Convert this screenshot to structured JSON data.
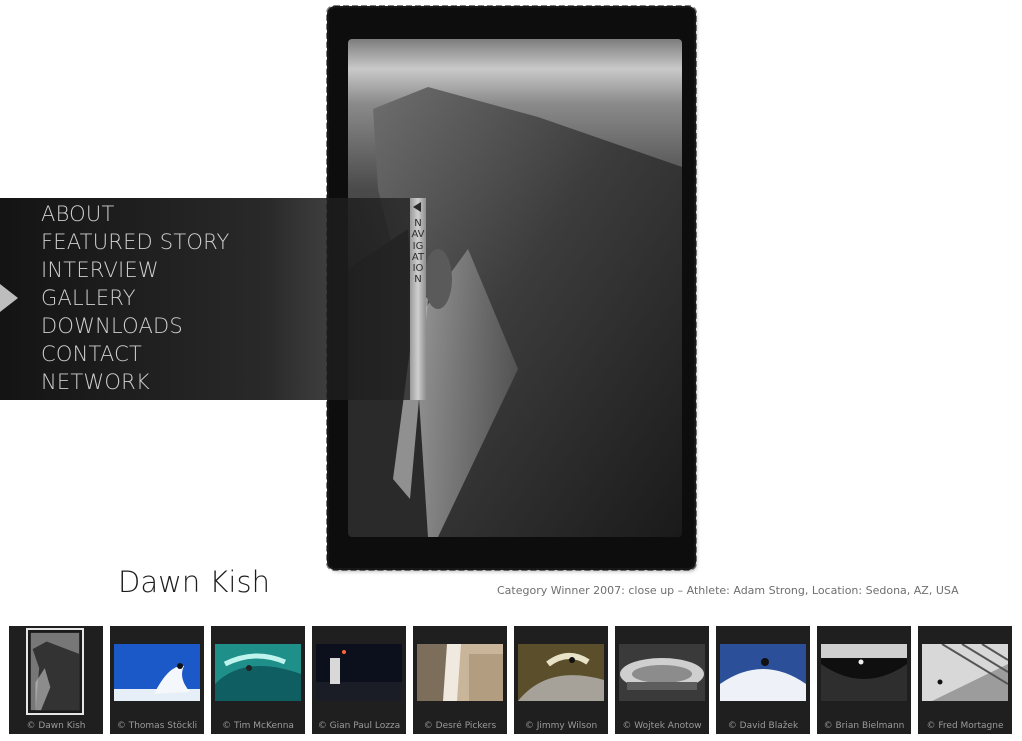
{
  "navigation": {
    "tab_label": "NAVIGATION",
    "items": [
      "ABOUT",
      "FEATURED STORY",
      "INTERVIEW",
      "GALLERY",
      "DOWNLOADS",
      "CONTACT",
      "NETWORK"
    ],
    "active_item": "GALLERY"
  },
  "photo": {
    "photographer": "Dawn Kish",
    "caption": "Category Winner 2007: close up – Athlete: Adam Strong, Location: Sedona, AZ, USA"
  },
  "thumbnails": [
    {
      "credit": "© Dawn Kish",
      "selected": true
    },
    {
      "credit": "© Thomas Stöckli"
    },
    {
      "credit": "© Tim McKenna"
    },
    {
      "credit": "© Gian Paul Lozza"
    },
    {
      "credit": "© Desré Pickers"
    },
    {
      "credit": "© Jimmy Wilson"
    },
    {
      "credit": "© Wojtek Anotow"
    },
    {
      "credit": "© David Blažek"
    },
    {
      "credit": "© Brian Bielmann"
    },
    {
      "credit": "© Fred Mortagne"
    }
  ],
  "colors": {
    "nav_background": "#141414",
    "nav_text": "#cfcfcf",
    "thumb_background": "#1f1f1f"
  }
}
